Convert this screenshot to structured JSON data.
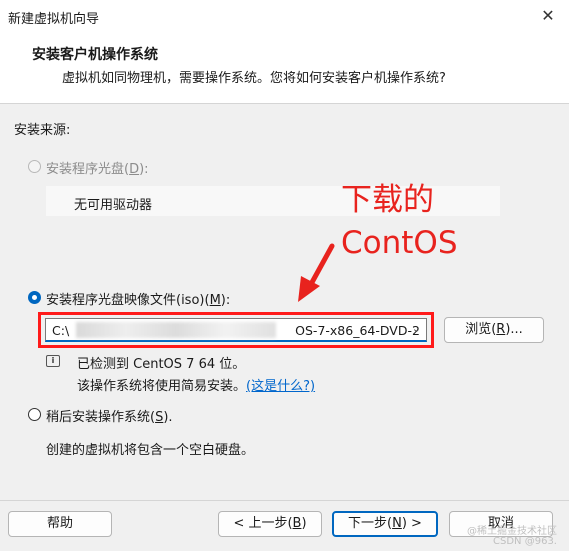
{
  "window": {
    "title": "新建虚拟机向导",
    "close_glyph": "✕"
  },
  "header": {
    "title": "安装客户机操作系统",
    "subtitle": "虚拟机如同物理机，需要操作系统。您将如何安装客户机操作系统?"
  },
  "source_label": "安装来源:",
  "option_disc": {
    "label_pre": "安装程序光盘(",
    "key": "D",
    "label_post": "):",
    "drive_value": "无可用驱动器"
  },
  "option_iso": {
    "label_pre": "安装程序光盘映像文件(iso)(",
    "key": "M",
    "label_post": "):",
    "path_start": "C:\\",
    "path_end": "OS-7-x86_64-DVD-2",
    "browse_pre": "浏览(",
    "browse_key": "R",
    "browse_post": ")...",
    "detect_line": "已检测到 CentOS 7 64 位。",
    "easy_install_pre": "该操作系统将使用简易安装。",
    "easy_install_link": "(这是什么?)"
  },
  "option_later": {
    "label_pre": "稍后安装操作系统(",
    "key": "S",
    "label_post": ").",
    "description": "创建的虚拟机将包含一个空白硬盘。"
  },
  "annotation": {
    "line1": "下载的",
    "line2": "ContOS"
  },
  "footer": {
    "help": "帮助",
    "back_pre": "< 上一步(",
    "back_key": "B",
    "back_post": ")",
    "next_pre": "下一步(",
    "next_key": "N",
    "next_post": ") >",
    "cancel": "取消"
  },
  "watermark": {
    "line1": "@稀土掘金技术社区",
    "line2": "CSDN @963."
  },
  "colors": {
    "accent": "#0067c0",
    "annotation_red": "#e8231e",
    "link": "#0066cc"
  }
}
